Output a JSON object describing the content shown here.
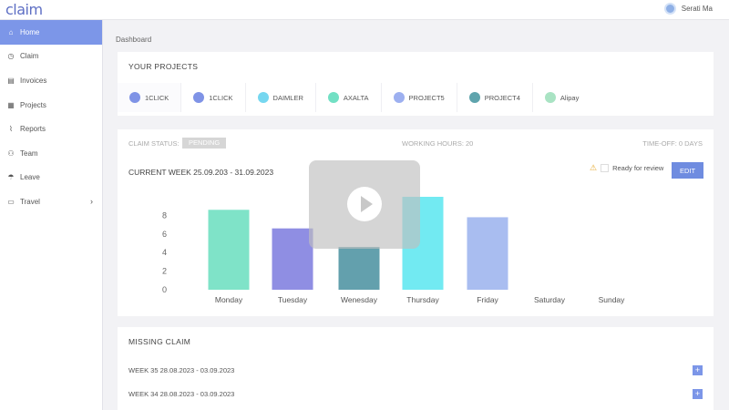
{
  "app": {
    "logo": "claim",
    "user_name": "Serati Ma"
  },
  "sidebar": {
    "items": [
      {
        "label": "Home",
        "icon": "home-icon",
        "glyph": "⌂"
      },
      {
        "label": "Claim",
        "icon": "clock-icon",
        "glyph": "◷"
      },
      {
        "label": "Invoices",
        "icon": "document-icon",
        "glyph": "▤"
      },
      {
        "label": "Projects",
        "icon": "folder-icon",
        "glyph": "▦"
      },
      {
        "label": "Reports",
        "icon": "chart-icon",
        "glyph": "⌇"
      },
      {
        "label": "Team",
        "icon": "users-icon",
        "glyph": "⚇"
      },
      {
        "label": "Leave",
        "icon": "umbrella-icon",
        "glyph": "☂"
      },
      {
        "label": "Travel",
        "icon": "car-icon",
        "glyph": "▭"
      }
    ],
    "travel_chevron": "›"
  },
  "breadcrumb": "Dashboard",
  "projects_card": {
    "title": "YOUR PROJECTS",
    "projects": [
      {
        "name": "1CLICK",
        "color": "#7f93e6"
      },
      {
        "name": "1CLICK",
        "color": "#7f93e6"
      },
      {
        "name": "DAIMLER",
        "color": "#76d7f0"
      },
      {
        "name": "AXALTA",
        "color": "#72e0c4"
      },
      {
        "name": "PROJECT5",
        "color": "#9db0f0"
      },
      {
        "name": "PROJECT4",
        "color": "#5fa4ad"
      },
      {
        "name": "Alipay",
        "color": "#a9e3c3"
      }
    ]
  },
  "week_card": {
    "claim_status_label": "CLAIM STATUS:",
    "claim_status_value": "PENDING",
    "working_hours": "WORKING HOURS: 20",
    "time_off": "TIME-OFF: 0 DAYS",
    "current_week": "CURRENT WEEK  25.09.203 - 31.09.2023",
    "ready_label": "Ready for review",
    "edit_label": "EDIT"
  },
  "chart_data": {
    "type": "bar",
    "categories": [
      "Monday",
      "Tuesday",
      "Wenesday",
      "Thursday",
      "Friday",
      "Saturday",
      "Sunday"
    ],
    "values": [
      8.6,
      6.6,
      4.6,
      10,
      7.8,
      0,
      0
    ],
    "colors": [
      "#7fe3c8",
      "#8f8ee3",
      "#63a0ad",
      "#72eaf2",
      "#a9bdf0",
      "#cccccc",
      "#cccccc"
    ],
    "y_ticks": [
      0,
      2,
      4,
      6,
      8
    ],
    "ylim": [
      0,
      10
    ],
    "title": "",
    "xlabel": "",
    "ylabel": ""
  },
  "missing_card": {
    "title": "MISSING CLAIM",
    "rows": [
      {
        "label": "WEEK 35   28.08.2023  - 03.09.2023"
      },
      {
        "label": "WEEK 34   28.08.2023  - 03.09.2023"
      }
    ],
    "add_symbol": "+"
  },
  "video_overlay": {
    "icon": "play-icon"
  }
}
